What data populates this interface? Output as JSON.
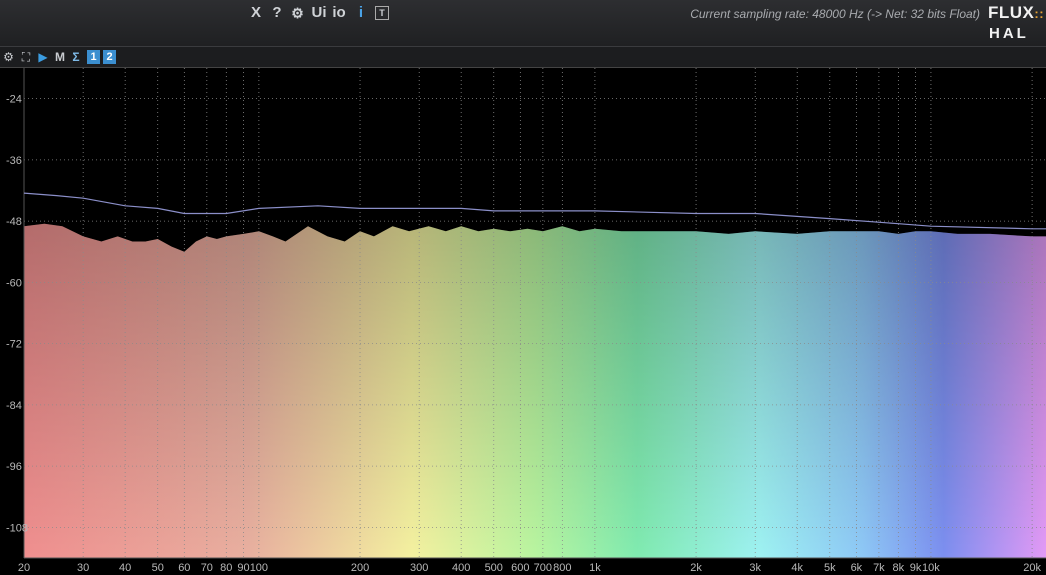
{
  "toolbar": {
    "close_label": "X",
    "help_label": "?",
    "settings_icon": "gear-icon",
    "ui_label": "Ui",
    "io_label": "io",
    "info_label": "i",
    "text_icon_label": "T",
    "sampling_rate_text": "Current sampling rate: 48000 Hz (-> Net: 32 bits Float)",
    "logo_top": "FLUX",
    "logo_bottom": "HAL"
  },
  "toolbar2": {
    "settings_icon": "gear-icon",
    "fullscreen_icon": "expand-icon",
    "play_icon": "play-icon",
    "m_label": "M",
    "sigma_label": "Σ",
    "channel1_label": "1",
    "channel2_label": "2"
  },
  "chart_data": {
    "type": "area",
    "title": "",
    "xlabel": "",
    "ylabel": "",
    "x_scale": "log",
    "xlim": [
      20,
      22000
    ],
    "ylim": [
      -114,
      -18
    ],
    "y_ticks": [
      -24,
      -36,
      -48,
      -60,
      -72,
      -84,
      -96,
      -108
    ],
    "x_ticks": [
      "20",
      "30",
      "40",
      "50",
      "60",
      "70",
      "80",
      "90",
      "100",
      "200",
      "300",
      "400",
      "500",
      "600",
      "700",
      "800",
      "1k",
      "2k",
      "3k",
      "4k",
      "5k",
      "6k",
      "7k",
      "8k",
      "9k",
      "10k",
      "20k"
    ],
    "grid": true,
    "colors": {
      "background": "#000000",
      "grid": "#8a8a8a",
      "peak_line": "#8b8fc9",
      "fill_low": "#f08a8a",
      "fill_high": "#d98af5",
      "dip_fill": "#4f6f86"
    },
    "series": [
      {
        "values_x": [
          20,
          23,
          26,
          30,
          34,
          38,
          42,
          46,
          50,
          55,
          60,
          65,
          70,
          75,
          80,
          90,
          100,
          110,
          120,
          140,
          160,
          180,
          200,
          220,
          250,
          280,
          320,
          360,
          400,
          450,
          500,
          560,
          630,
          700,
          800,
          900,
          1000,
          1200,
          1500,
          2000,
          2500,
          3000,
          4000,
          5000,
          6000,
          7000,
          8000,
          9000,
          10000,
          12000,
          15000,
          20000,
          22000
        ],
        "values": [
          -49,
          -48.5,
          -49,
          -51,
          -52,
          -51,
          -52,
          -52,
          -51.5,
          -53,
          -54,
          -52,
          -51,
          -51.5,
          -51,
          -50.5,
          -50,
          -51,
          -52,
          -49,
          -51,
          -52,
          -50,
          -51,
          -49,
          -50,
          -49,
          -50,
          -49,
          -50,
          -49.5,
          -50,
          -49.5,
          -50,
          -49,
          -50,
          -49.5,
          -50,
          -50,
          -50,
          -50.5,
          -50,
          -50.5,
          -50,
          -50,
          -50,
          -50.5,
          -50,
          -50,
          -50.5,
          -50.5,
          -51,
          -51
        ]
      },
      {
        "name": "",
        "values_x": [
          20,
          25,
          30,
          40,
          50,
          60,
          80,
          100,
          150,
          200,
          300,
          400,
          500,
          700,
          1000,
          2000,
          3000,
          5000,
          8000,
          10000,
          20000,
          22000
        ],
        "values": [
          -42.5,
          -43,
          -43.5,
          -45,
          -45.5,
          -46.5,
          -46.5,
          -45.5,
          -45,
          -45.5,
          -45.5,
          -45.5,
          -46,
          -46,
          -46,
          -46.5,
          -46.5,
          -47.5,
          -48.5,
          -49,
          -49.5,
          -49.5
        ]
      }
    ]
  }
}
